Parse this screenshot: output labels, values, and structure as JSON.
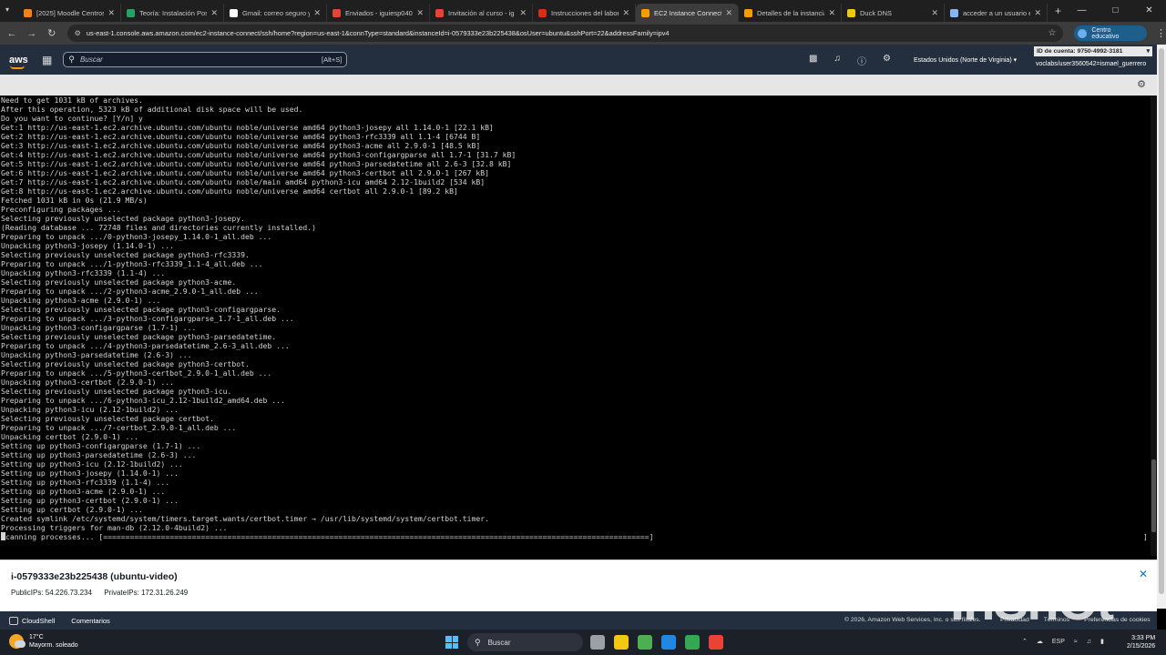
{
  "browser": {
    "tabs": [
      {
        "label": "[2025] Moodle Centros",
        "color": "#f98012",
        "active": false
      },
      {
        "label": "Teoría: Instalación Post",
        "color": "#21a366",
        "active": false
      },
      {
        "label": "Gmail: correo seguro y",
        "color": "#ffffff",
        "active": false
      },
      {
        "label": "Enviados - iguiesp040",
        "color": "#ea4335",
        "active": false
      },
      {
        "label": "Invitación al curso - ig",
        "color": "#ea4335",
        "active": false
      },
      {
        "label": "Instrucciones del labor",
        "color": "#d13212",
        "active": false
      },
      {
        "label": "EC2 Instance Connect |",
        "color": "#ff9900",
        "active": true
      },
      {
        "label": "Detalles de la instancia",
        "color": "#ff9900",
        "active": false
      },
      {
        "label": "Duck DNS",
        "color": "#f2c811",
        "active": false
      },
      {
        "label": "acceder a un usuario e",
        "color": "#8ab4f8",
        "active": false
      }
    ],
    "new_tab": "+",
    "url": "us-east-1.console.aws.amazon.com/ec2-instance-connect/ssh/home?region=us-east-1&connType=standard&instanceId=i-0579333e23b225438&osUser=ubuntu&sshPort=22&addressFamily=ipv4",
    "profile_label": "Centro educativo"
  },
  "aws_header": {
    "logo": "aws",
    "search_placeholder": "Buscar",
    "search_shortcut": "[Alt+S]",
    "region": "Estados Unidos (Norte de Virginia) ▾",
    "account_id": "ID de cuenta: 9750-4992-3181",
    "user": "voclabs/user3560542=ismael_guerrero"
  },
  "terminal": {
    "lines": [
      "Need to get 1031 kB of archives.",
      "After this operation, 5323 kB of additional disk space will be used.",
      "Do you want to continue? [Y/n] y",
      "Get:1 http://us-east-1.ec2.archive.ubuntu.com/ubuntu noble/universe amd64 python3-josepy all 1.14.0-1 [22.1 kB]",
      "Get:2 http://us-east-1.ec2.archive.ubuntu.com/ubuntu noble/universe amd64 python3-rfc3339 all 1.1-4 [6744 B]",
      "Get:3 http://us-east-1.ec2.archive.ubuntu.com/ubuntu noble/universe amd64 python3-acme all 2.9.0-1 [48.5 kB]",
      "Get:4 http://us-east-1.ec2.archive.ubuntu.com/ubuntu noble/universe amd64 python3-configargparse all 1.7-1 [31.7 kB]",
      "Get:5 http://us-east-1.ec2.archive.ubuntu.com/ubuntu noble/universe amd64 python3-parsedatetime all 2.6-3 [32.8 kB]",
      "Get:6 http://us-east-1.ec2.archive.ubuntu.com/ubuntu noble/universe amd64 python3-certbot all 2.9.0-1 [267 kB]",
      "Get:7 http://us-east-1.ec2.archive.ubuntu.com/ubuntu noble/main amd64 python3-icu amd64 2.12-1build2 [534 kB]",
      "Get:8 http://us-east-1.ec2.archive.ubuntu.com/ubuntu noble/universe amd64 certbot all 2.9.0-1 [89.2 kB]",
      "Fetched 1031 kB in 0s (21.9 MB/s)",
      "Preconfiguring packages ...",
      "Selecting previously unselected package python3-josepy.",
      "(Reading database ... 72748 files and directories currently installed.)",
      "Preparing to unpack .../0-python3-josepy_1.14.0-1_all.deb ...",
      "Unpacking python3-josepy (1.14.0-1) ...",
      "Selecting previously unselected package python3-rfc3339.",
      "Preparing to unpack .../1-python3-rfc3339_1.1-4_all.deb ...",
      "Unpacking python3-rfc3339 (1.1-4) ...",
      "Selecting previously unselected package python3-acme.",
      "Preparing to unpack .../2-python3-acme_2.9.0-1_all.deb ...",
      "Unpacking python3-acme (2.9.0-1) ...",
      "Selecting previously unselected package python3-configargparse.",
      "Preparing to unpack .../3-python3-configargparse_1.7-1_all.deb ...",
      "Unpacking python3-configargparse (1.7-1) ...",
      "Selecting previously unselected package python3-parsedatetime.",
      "Preparing to unpack .../4-python3-parsedatetime_2.6-3_all.deb ...",
      "Unpacking python3-parsedatetime (2.6-3) ...",
      "Selecting previously unselected package python3-certbot.",
      "Preparing to unpack .../5-python3-certbot_2.9.0-1_all.deb ...",
      "Unpacking python3-certbot (2.9.0-1) ...",
      "Selecting previously unselected package python3-icu.",
      "Preparing to unpack .../6-python3-icu_2.12-1build2_amd64.deb ...",
      "Unpacking python3-icu (2.12-1build2) ...",
      "Selecting previously unselected package certbot.",
      "Preparing to unpack .../7-certbot_2.9.0-1_all.deb ...",
      "Unpacking certbot (2.9.0-1) ...",
      "Setting up python3-configargparse (1.7-1) ...",
      "Setting up python3-parsedatetime (2.6-3) ...",
      "Setting up python3-icu (2.12-1build2) ...",
      "Setting up python3-josepy (1.14.0-1) ...",
      "Setting up python3-rfc3339 (1.1-4) ...",
      "Setting up python3-acme (2.9.0-1) ...",
      "Setting up python3-certbot (2.9.0-1) ...",
      "Setting up certbot (2.9.0-1) ...",
      "Created symlink /etc/systemd/system/timers.target.wants/certbot.timer → /usr/lib/systemd/system/certbot.timer.",
      "Processing triggers for man-db (2.12.0-4build2) ..."
    ],
    "last_line": "canning processes... [===========================================================================================================================]",
    "right_bracket": "]"
  },
  "instance": {
    "title": "i-0579333e23b225438 (ubuntu-video)",
    "public_ips": "PublicIPs: 54.226.73.234",
    "private_ips": "PrivateIPs: 172.31.26.249"
  },
  "footer": {
    "cloudshell": "CloudShell",
    "feedback": "Comentarios",
    "copyright": "© 2026, Amazon Web Services, Inc. o sus filiales.",
    "links": [
      "Privacidad",
      "Términos",
      "Preferencias de cookies"
    ]
  },
  "watermark": "InShOt",
  "taskbar": {
    "temperature": "17°C",
    "weather": "Mayorm. soleado",
    "search": "Buscar",
    "language": "ESP",
    "time": "3:33 PM",
    "date": "2/15/2026",
    "apps": [
      "#9aa0a6",
      "#f2c811",
      "#4caf50",
      "#1e88e5",
      "#34a853",
      "#ea4335"
    ]
  }
}
